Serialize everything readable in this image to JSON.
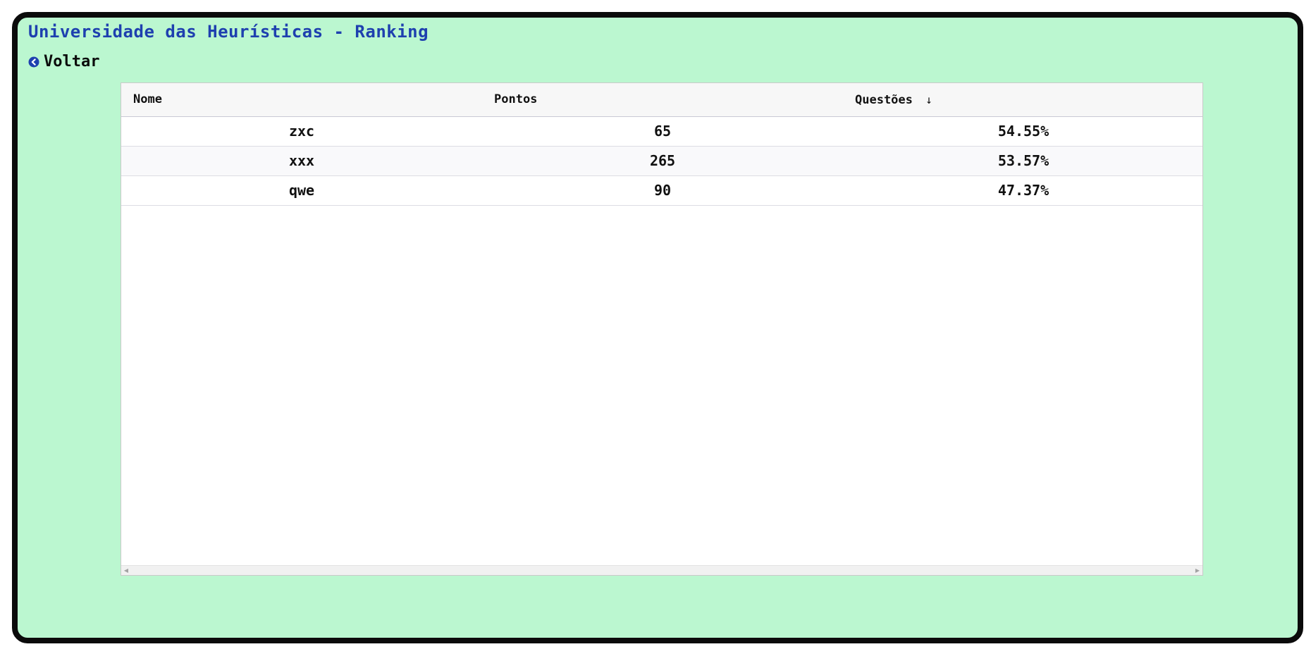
{
  "page": {
    "title": "Universidade das Heurísticas - Ranking"
  },
  "nav": {
    "back_label": "Voltar",
    "back_icon": "arrow-left-circle-icon"
  },
  "table": {
    "columns": [
      {
        "label": "Nome"
      },
      {
        "label": "Pontos"
      },
      {
        "label": "Questões",
        "sort_icon": "↓"
      }
    ],
    "rows": [
      {
        "nome": "zxc",
        "pontos": "65",
        "questoes": "54.55%"
      },
      {
        "nome": "xxx",
        "pontos": "265",
        "questoes": "53.57%"
      },
      {
        "nome": "qwe",
        "pontos": "90",
        "questoes": "47.37%"
      }
    ]
  },
  "scrollbar": {
    "left_arrow": "◀",
    "right_arrow": "▶"
  },
  "colors": {
    "background": "#bbf7d0",
    "frame_border": "#0b0b0b",
    "title": "#1e40af",
    "back_icon": "#1e40af"
  }
}
